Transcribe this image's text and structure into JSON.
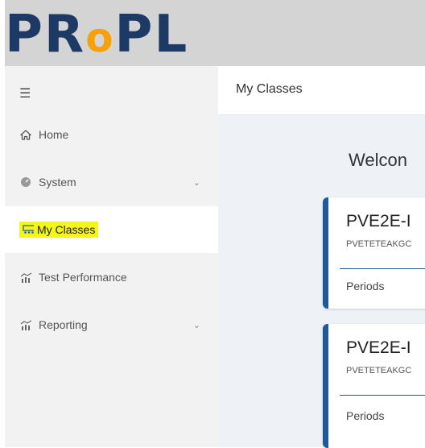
{
  "logo": {
    "part1": "PR",
    "part2": "o",
    "part3": "PL"
  },
  "sidebar": {
    "menu_icon": "☰",
    "items": [
      {
        "label": "Home",
        "icon": "home-icon"
      },
      {
        "label": "System",
        "icon": "gauge-icon",
        "expandable": true
      },
      {
        "label": "My Classes",
        "icon": "classroom-icon",
        "active": true
      },
      {
        "label": "Test Performance",
        "icon": "bar-chart-icon"
      },
      {
        "label": "Reporting",
        "icon": "bar-chart-icon",
        "expandable": true
      }
    ]
  },
  "header": {
    "title": "My Classes"
  },
  "main": {
    "welcome": "Welcon",
    "cards": [
      {
        "title": "PVE2E-I",
        "code": "PVETETEAKGC",
        "periods_label": "Periods"
      },
      {
        "title": "PVE2E-I",
        "code": "PVETETEAKGC",
        "periods_label": "Periods"
      }
    ]
  },
  "colors": {
    "brand_dark": "#1d3a66",
    "brand_orange": "#f5a20a",
    "accent_blue": "#1d5a9c",
    "highlight": "#f4f61a"
  }
}
